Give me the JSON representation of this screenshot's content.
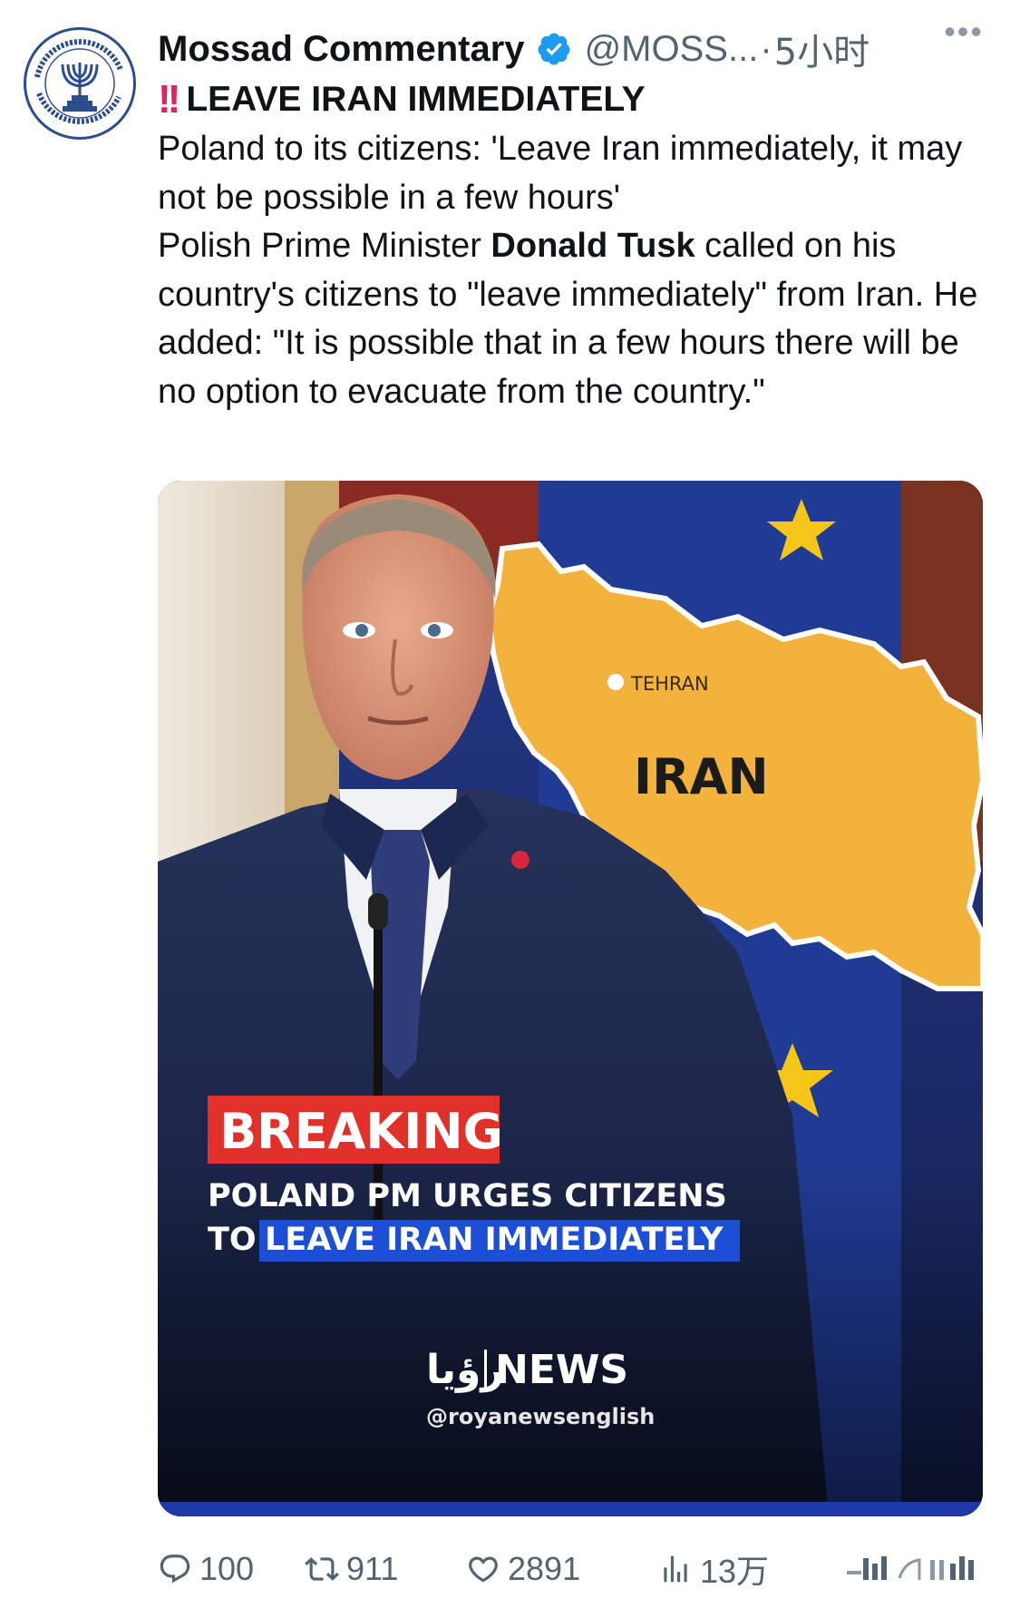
{
  "author": {
    "name": "Mossad Commentary",
    "handle": "@MOSS...",
    "separator": "·",
    "time": "5小时",
    "more_label": "•••"
  },
  "post": {
    "headline_emoji": "‼️",
    "headline_bang": "!!",
    "headline": "LEAVE IRAN IMMEDIATELY",
    "line1": "Poland to its citizens: 'Leave Iran immediately, it may not be possible in a few hours'",
    "line2_prefix": "Polish Prime Minister ",
    "line2_bold": "Donald Tusk",
    "line2_suffix": " called on his country's citizens to \"leave immediately\" from Iran. He added: \"It is possible that in a few hours there will be no option to evacuate from the country.\""
  },
  "media": {
    "map_city": "TEHRAN",
    "map_country": "IRAN",
    "breaking_label": "BREAKING",
    "caption_line1": "POLAND PM URGES CITIZENS",
    "caption_line2_prefix": "TO",
    "caption_line2_highlight": "LEAVE IRAN IMMEDIATELY",
    "brand_mark": "رؤيا",
    "brand_name": "NEWS",
    "brand_handle": "@royanewsenglish",
    "colors": {
      "map_fill": "#f2b23b",
      "breaking_red": "#e0302a",
      "highlight_blue": "#1d4fd6",
      "eu_blue": "#1c3a8c",
      "eu_star": "#f5c518"
    }
  },
  "actions": {
    "replies": "100",
    "reposts": "911",
    "likes": "2891",
    "views": "13万"
  },
  "colors": {
    "text": "#0f1419",
    "secondary": "#536471",
    "verified": "#1d9bf0"
  }
}
